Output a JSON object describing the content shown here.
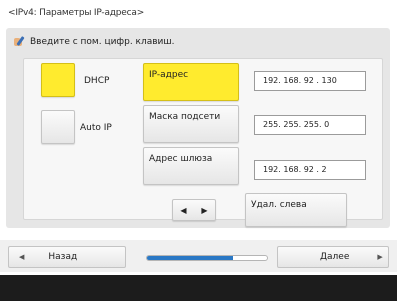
{
  "screen": {
    "title": "<IPv4: Параметры IP-адреса>",
    "hint": "Введите с пом. цифр. клавиш.",
    "hint_icon": "keypad-input-icon"
  },
  "mode": {
    "dhcp_label": "DHCP",
    "dhcp_selected": true,
    "autoip_label": "Auto IP",
    "autoip_selected": false
  },
  "fields": {
    "ip_label": "IP-адрес",
    "ip_value": "192. 168. 92 . 130",
    "ip_selected": true,
    "mask_label": "Маска подсети",
    "mask_value": "255. 255. 255. 0",
    "gateway_label": "Адрес шлюза",
    "gateway_value": "192. 168. 92 . 2"
  },
  "cursor": {
    "left_icon": "◀",
    "right_icon": "▶"
  },
  "delete_left_label": "Удал. слева",
  "navigation": {
    "back_label": "Назад",
    "back_icon": "◀",
    "next_label": "Далее",
    "next_icon": "▶",
    "progress_fraction": 0.72
  },
  "colors": {
    "selected": "#ffeb2e",
    "progress": "#2a78c5"
  }
}
